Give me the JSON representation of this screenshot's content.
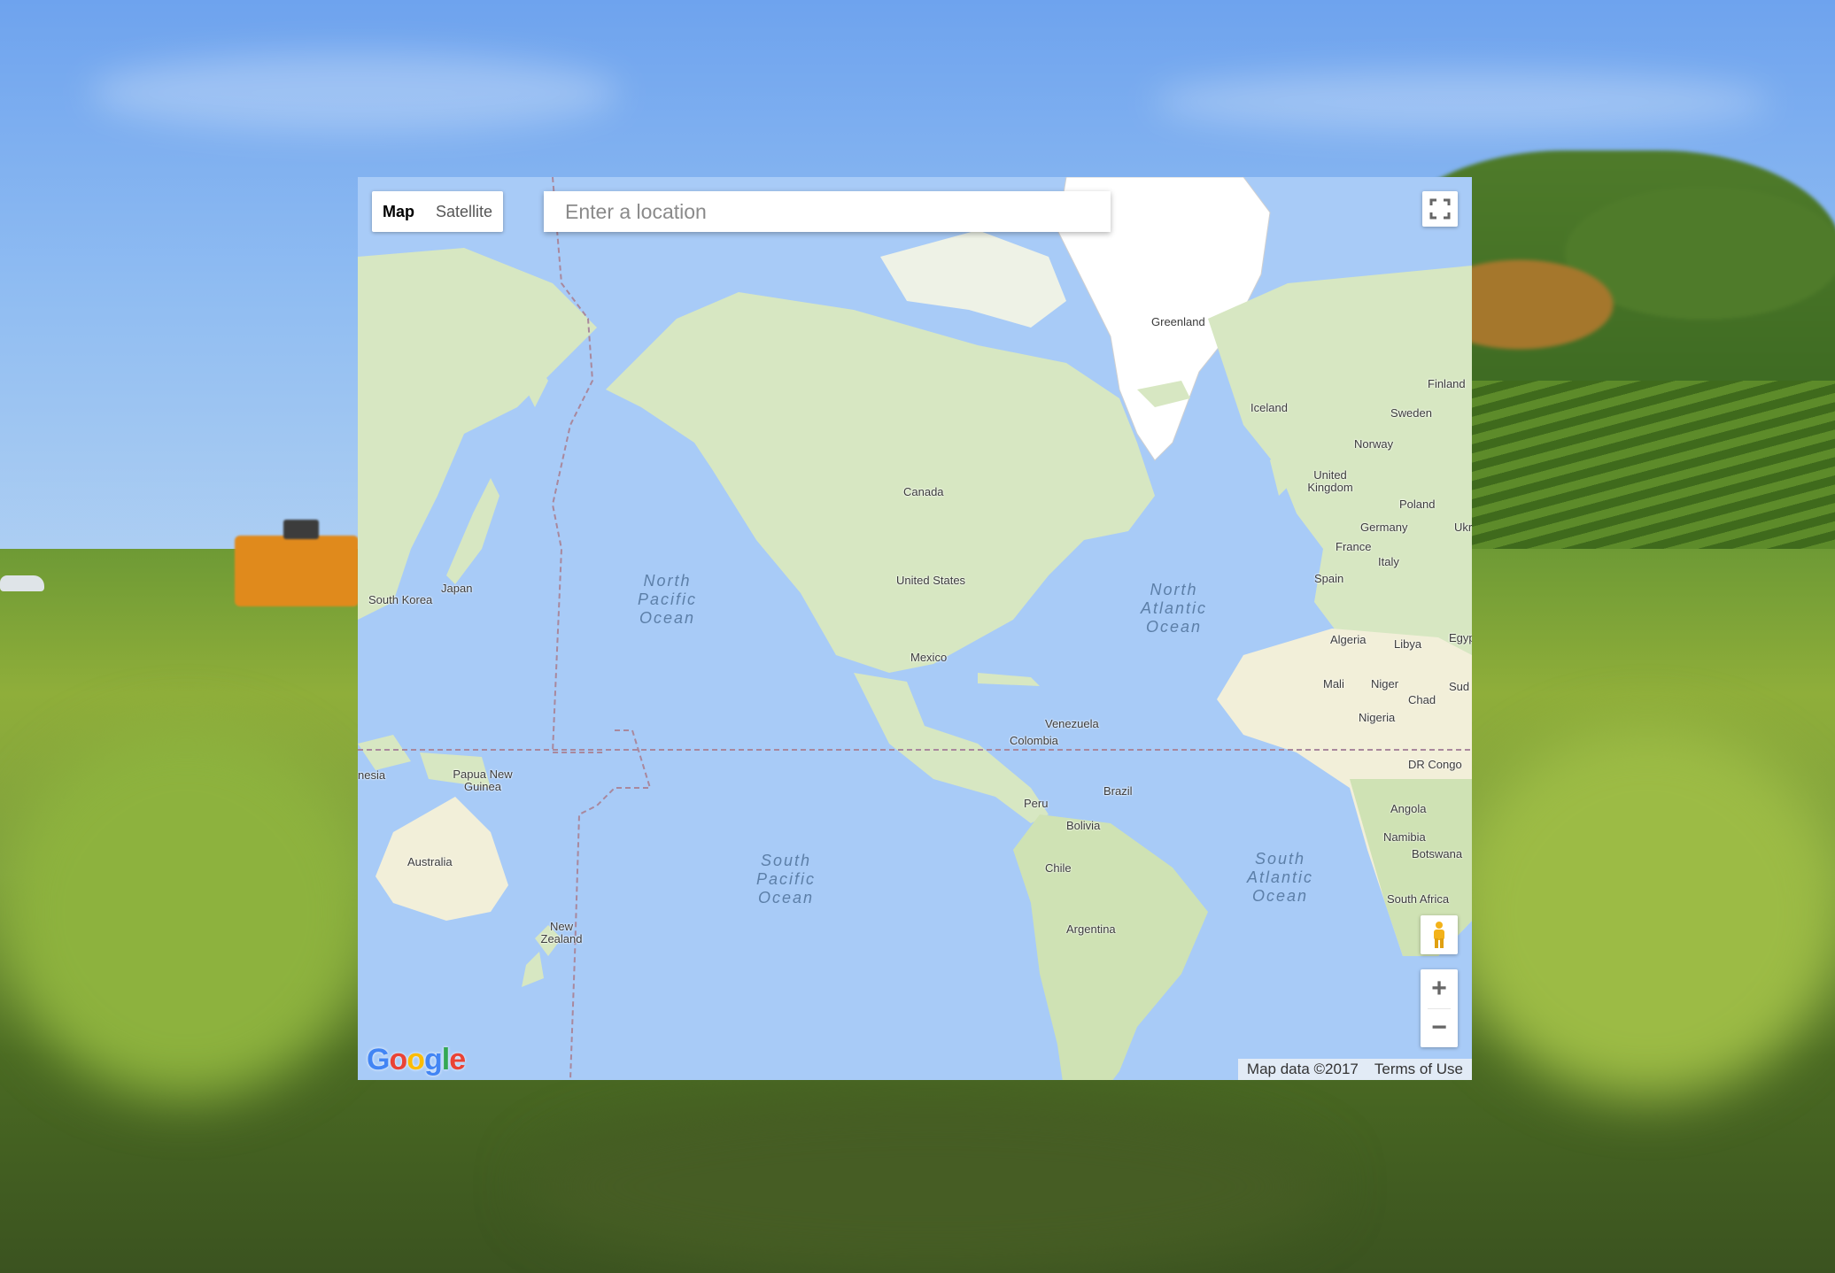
{
  "map_controls": {
    "map_type": [
      "Map",
      "Satellite"
    ],
    "active_type": "Map",
    "search_placeholder": "Enter a location",
    "zoom_in": "+",
    "zoom_out": "−"
  },
  "map_labels": {
    "countries": [
      "Greenland",
      "Finland",
      "Iceland",
      "Sweden",
      "Norway",
      "United Kingdom",
      "Poland",
      "Germany",
      "Ukr",
      "France",
      "Italy",
      "Spain",
      "Canada",
      "United States",
      "Mexico",
      "Japan",
      "South Korea",
      "Algeria",
      "Libya",
      "Egyp",
      "Mali",
      "Niger",
      "Sud",
      "Chad",
      "Nigeria",
      "Venezuela",
      "Colombia",
      "DR Congo",
      "Brazil",
      "Peru",
      "Bolivia",
      "Angola",
      "Namibia",
      "Botswana",
      "Chile",
      "South Africa",
      "Argentina",
      "Papua New Guinea",
      "nesia",
      "Australia",
      "New Zealand"
    ],
    "oceans": [
      "North\nPacific\nOcean",
      "North\nAtlantic\nOcean",
      "South\nPacific\nOcean",
      "South\nAtlantic\nOcean"
    ]
  },
  "footer": {
    "logo": "Google",
    "map_data": "Map data ©2017",
    "terms": "Terms of Use"
  },
  "icons": [
    "fullscreen-icon",
    "pegman-icon"
  ],
  "colors": {
    "water": "#a8cbf7",
    "land": "#d9e8c4",
    "ice": "#ffffff",
    "accent": "#4285f4"
  }
}
